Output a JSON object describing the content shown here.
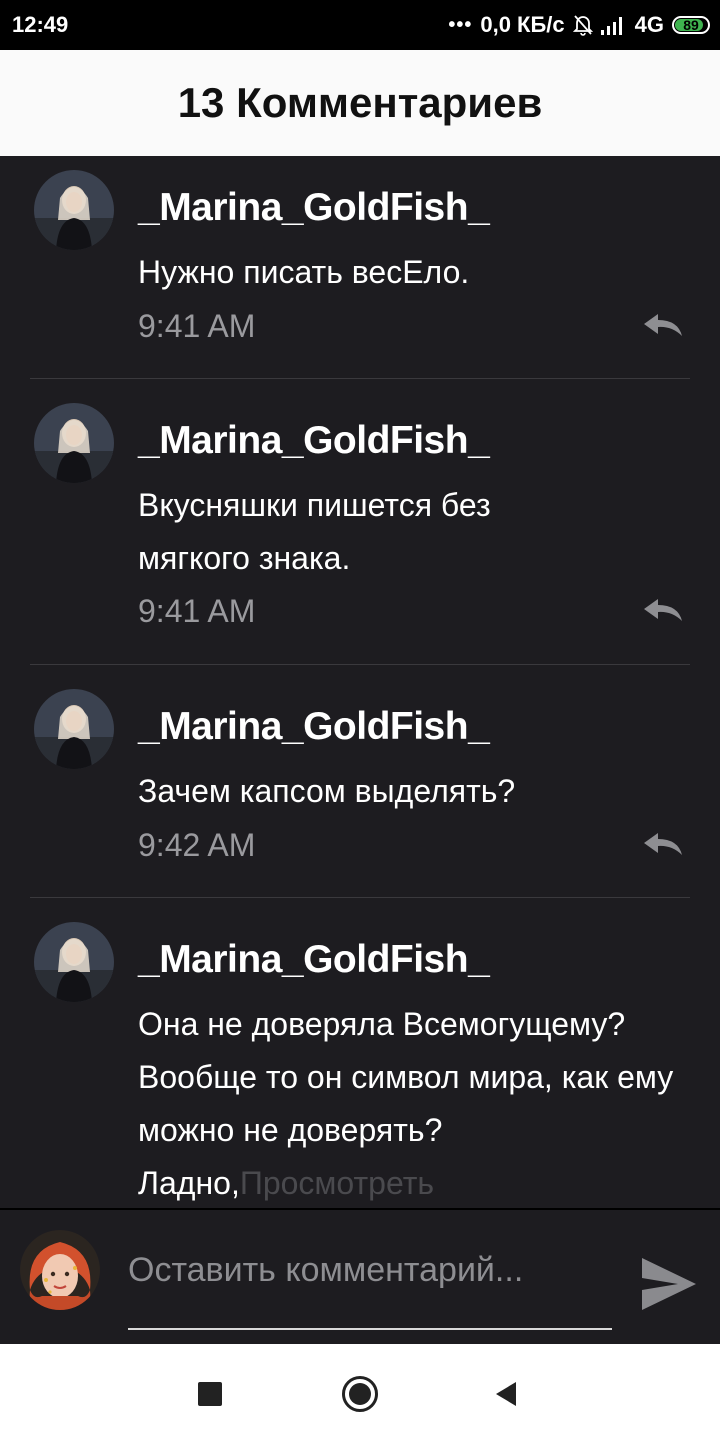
{
  "status_bar": {
    "time": "12:49",
    "dots": "•••",
    "speed": "0,0 КБ/с",
    "network": "4G",
    "battery_level": "89",
    "battery_fraction": 0.89,
    "battery_color": "#3fb34f"
  },
  "header": {
    "title": "13 Комментариев"
  },
  "comments": [
    {
      "username": "_Marina_GoldFish_",
      "text": "Нужно писать весЕло.",
      "time": "9:41 AM"
    },
    {
      "username": "_Marina_GoldFish_",
      "text": "Вкусняшки пишется без мягкого знака.",
      "time": "9:41 AM"
    },
    {
      "username": "_Marina_GoldFish_",
      "text": "Зачем капсом выделять?",
      "time": "9:42 AM"
    },
    {
      "username": "_Marina_GoldFish_",
      "text": "Она не доверяла Всемогущему? Вообще то он символ мира, как ему можно не доверять? Ладно,",
      "view_more": "Просмотреть"
    }
  ],
  "composer": {
    "placeholder": "Оставить комментарий..."
  },
  "icons": {
    "reply": "reply-arrow-icon",
    "send": "send-icon",
    "nav_recents": "square-icon",
    "nav_home": "circle-icon",
    "nav_back": "triangle-back-icon"
  }
}
